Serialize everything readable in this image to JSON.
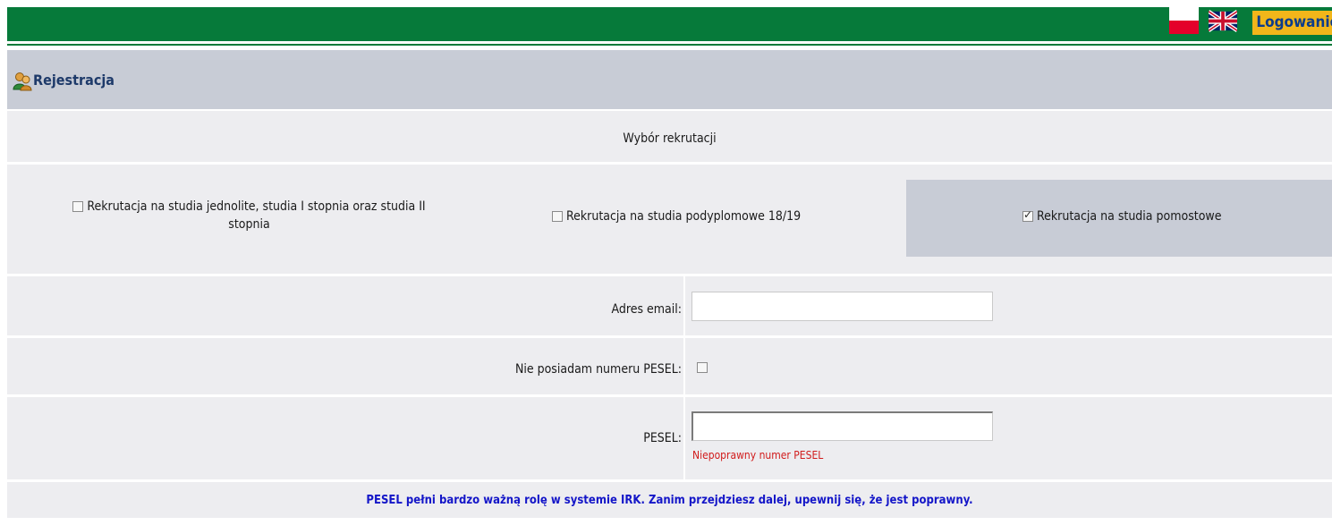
{
  "topbar": {
    "login_label": "Logowanie",
    "flags": [
      "pl-flag-icon",
      "uk-flag-icon"
    ],
    "color": "#067a3a",
    "login_bg": "#f2b61a"
  },
  "header": {
    "title": "Rejestracja",
    "icon": "user-icon"
  },
  "recruitment": {
    "heading": "Wybór rekrutacji",
    "options": [
      {
        "label_line1": "Rekrutacja na studia jednolite, studia I stopnia oraz studia II",
        "label_line2": "stopnia",
        "checked": false
      },
      {
        "label": "Rekrutacja na studia podyplomowe 18/19",
        "checked": false
      },
      {
        "label": "Rekrutacja na studia pomostowe",
        "checked": true
      }
    ]
  },
  "form": {
    "email_label": "Adres email:",
    "email_value": "",
    "no_pesel_label": "Nie posiadam numeru PESEL:",
    "no_pesel_checked": false,
    "pesel_label": "PESEL:",
    "pesel_value": "",
    "pesel_error": "Niepoprawny numer PESEL"
  },
  "note": "PESEL pełni bardzo ważną rolę w systemie IRK. Zanim przejdziesz dalej, upewnij się, że jest poprawny."
}
